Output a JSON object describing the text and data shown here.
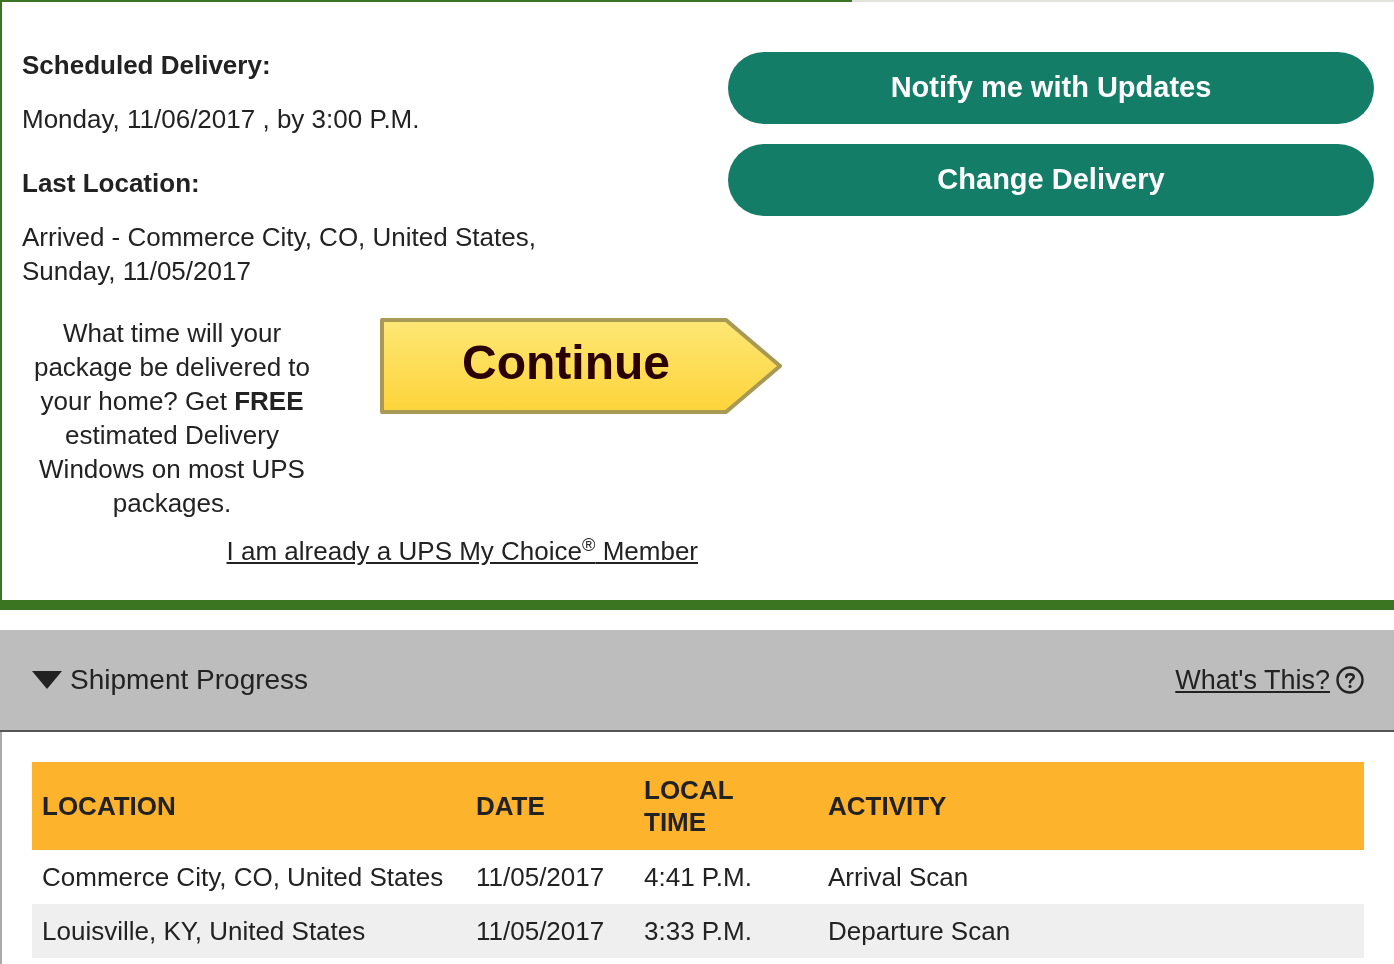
{
  "delivery": {
    "scheduled_label": "Scheduled Delivery:",
    "scheduled_value": "Monday, 11/06/2017 , by 3:00 P.M.",
    "last_location_label": "Last Location:",
    "last_location_lines": [
      "Arrived - Commerce City, CO, United States,",
      "Sunday, 11/05/2017"
    ]
  },
  "actions": [
    {
      "label": "Notify me with Updates"
    },
    {
      "label": "Change Delivery"
    }
  ],
  "promo": {
    "lines": [
      "What time will your",
      "package be delivered to",
      "your home? Get **FREE**",
      "estimated Delivery",
      "Windows on most UPS",
      "packages."
    ],
    "button": "Continue",
    "member_link": "I am already a UPS My Choice$^{®}$ Member"
  },
  "progress": {
    "title": "Shipment Progress",
    "expanded": true,
    "help_link": "What's This?",
    "table": {
      "columns": [
        "LOCATION",
        "DATE",
        "LOCAL TIME",
        "ACTIVITY"
      ],
      "rows": [
        [
          "Commerce City, CO, United States",
          "11/05/2017",
          "4:41 P.M.",
          "Arrival Scan"
        ],
        [
          "Louisville, KY, United States",
          "11/05/2017",
          "3:33 P.M.",
          "Departure Scan"
        ]
      ]
    }
  }
}
